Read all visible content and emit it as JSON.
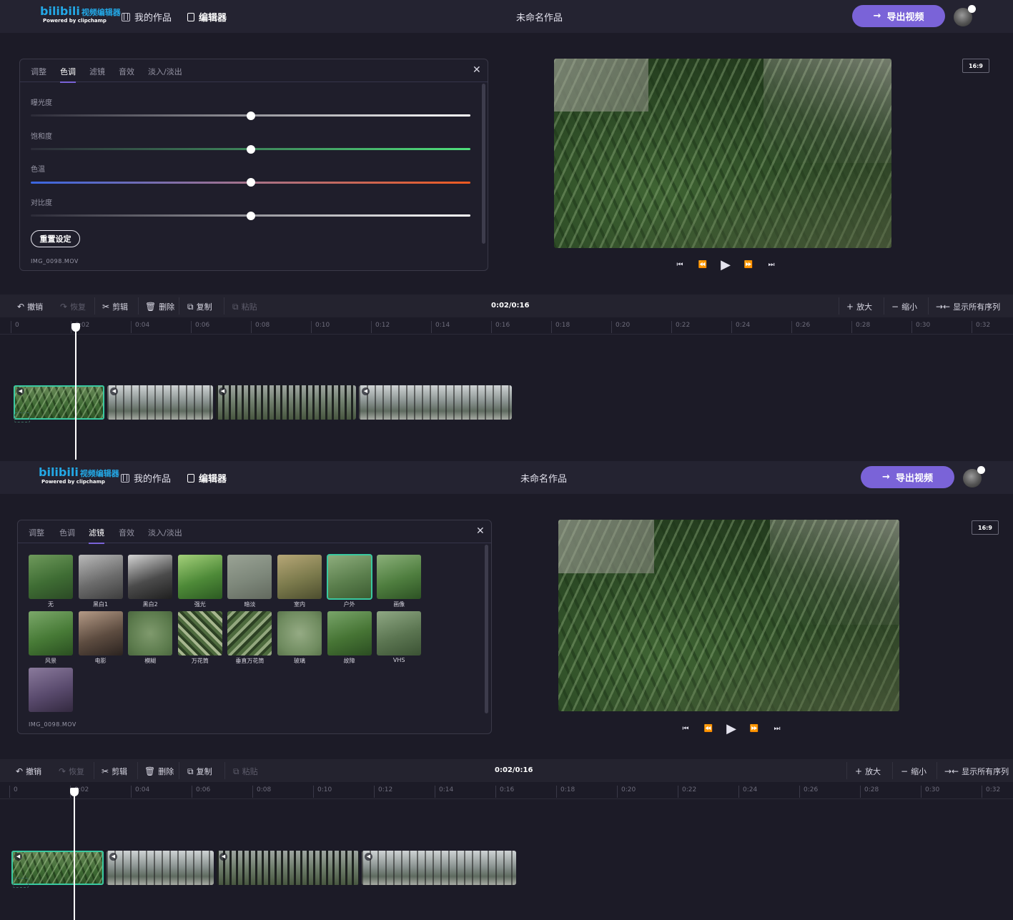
{
  "app": {
    "logo_main": "bilibili",
    "logo_sub": "视频编辑器",
    "logo_powered": "Powered by clipchamp",
    "nav_my_works": "我的作品",
    "nav_editor": "编辑器",
    "project_title": "未命名作品",
    "export_label": "导出视频",
    "aspect_ratio": "16:9"
  },
  "panel_tabs": [
    "调整",
    "色调",
    "滤镜",
    "音效",
    "淡入/淡出"
  ],
  "color_panel": {
    "active_tab": "色调",
    "sliders": [
      {
        "label": "曝光度",
        "value": 0.5
      },
      {
        "label": "饱和度",
        "value": 0.5
      },
      {
        "label": "色温",
        "value": 0.5
      },
      {
        "label": "对比度",
        "value": 0.5
      }
    ],
    "reset_label": "重置设定",
    "file_name": "IMG_0098.MOV"
  },
  "filter_panel": {
    "active_tab": "滤镜",
    "selected_filter": "户外",
    "filters": [
      "无",
      "黑白1",
      "黑白2",
      "强光",
      "暗淡",
      "室内",
      "户外",
      "画像",
      "风景",
      "电影",
      "模糊",
      "万花筒",
      "垂直万花筒",
      "玻璃",
      "故障",
      "VHS",
      ""
    ],
    "file_name": "IMG_0098.MOV"
  },
  "toolbar": {
    "undo": "撤销",
    "redo": "恢复",
    "cut": "剪辑",
    "delete": "删除",
    "copy": "复制",
    "paste": "粘贴",
    "timecode": "0:02/0:16",
    "zoom_in": "放大",
    "zoom_out": "缩小",
    "show_all": "显示所有序列"
  },
  "ruler_ticks": [
    "0",
    "0:02",
    "0:04",
    "0:06",
    "0:08",
    "0:10",
    "0:12",
    "0:14",
    "0:16",
    "0:18",
    "0:20",
    "0:22",
    "0:24",
    "0:26",
    "0:28",
    "0:30",
    "0:32"
  ],
  "playhead_seconds": 2,
  "icons": {
    "close": "close-icon",
    "play": "play-icon",
    "skip_start": "skip-start-icon",
    "rewind": "rewind-icon",
    "fast_forward": "fast-forward-icon",
    "skip_end": "skip-end-icon"
  },
  "colors": {
    "accent": "#7a63d8",
    "selection": "#39c9a0",
    "logo": "#23a8e6"
  }
}
